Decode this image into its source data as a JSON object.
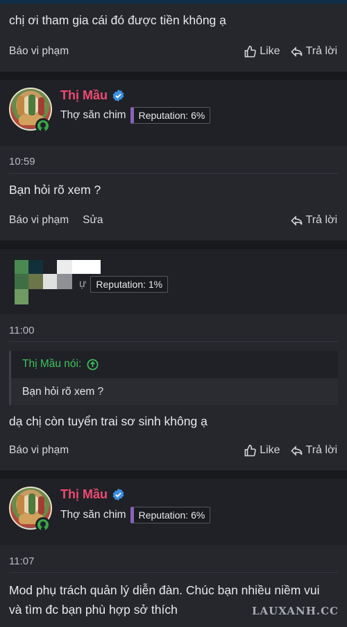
{
  "post1": {
    "text": "chị ơi tham gia cái đó được tiền không ạ",
    "report_label": "Báo vi phạm",
    "like_label": "Like",
    "reply_label": "Trả lời"
  },
  "user1": {
    "name": "Thị Mầu",
    "title": "Thợ săn chim",
    "reputation": "Reputation: 6%"
  },
  "post2": {
    "time": "10:59",
    "text": "Bạn hỏi rõ xem ?",
    "report_label": "Báo vi phạm",
    "edit_label": "Sửa",
    "reply_label": "Trả lời"
  },
  "user2": {
    "title_partial": "ự",
    "reputation": "Reputation: 1%"
  },
  "post3": {
    "time": "11:00",
    "quote_author": "Thị Mầu nói:",
    "quote_text": "Bạn hỏi rõ xem ?",
    "text": "dạ chị còn tuyển trai sơ sinh không ạ",
    "report_label": "Báo vi phạm",
    "like_label": "Like",
    "reply_label": "Trả lời"
  },
  "user3": {
    "name": "Thị Mầu",
    "title": "Thợ săn chim",
    "reputation": "Reputation: 6%"
  },
  "post4": {
    "time": "11:07",
    "text": "Mod phụ trách quản lý diễn đàn. Chúc bạn nhiều niềm vui và tìm đc bạn phù hợp sở thích"
  },
  "watermark": "LAUXANH.CC",
  "colors": {
    "username": "#ef4a73",
    "quote_author": "#3dc35d",
    "online": "#3aa84b",
    "verified": "#3d8fe0"
  },
  "icons": [
    "thumbs-up-icon",
    "reply-icon",
    "verified-badge-icon",
    "online-status-icon",
    "quote-jump-icon"
  ]
}
